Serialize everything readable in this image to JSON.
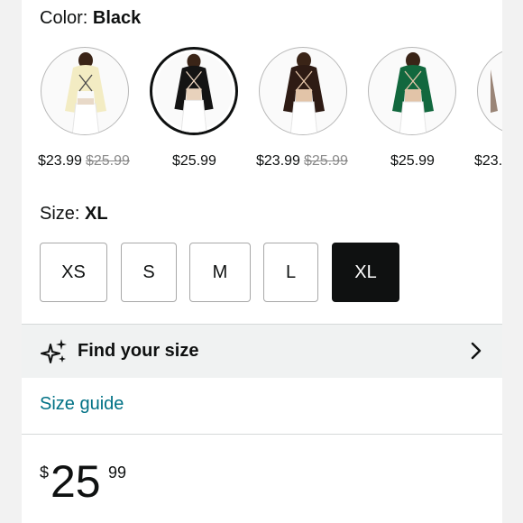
{
  "color": {
    "label": "Color:",
    "value": "Black"
  },
  "swatches": [
    {
      "name": "Cream",
      "price": "$23.99",
      "list_price": "$25.99",
      "selected": false,
      "shirt_color": "#f3ecc3"
    },
    {
      "name": "Black",
      "price": "$25.99",
      "list_price": "",
      "selected": true,
      "shirt_color": "#141414"
    },
    {
      "name": "Brown",
      "price": "$23.99",
      "list_price": "$25.99",
      "selected": false,
      "shirt_color": "#2e1b14"
    },
    {
      "name": "Green",
      "price": "$25.99",
      "list_price": "",
      "selected": false,
      "shirt_color": "#12683e"
    },
    {
      "name": "Taupe",
      "price": "$23.",
      "list_price": "",
      "selected": false,
      "shirt_color": "#9a8577"
    }
  ],
  "size": {
    "label": "Size:",
    "value": "XL",
    "options": [
      "XS",
      "S",
      "M",
      "L",
      "XL"
    ],
    "selected": "XL"
  },
  "find_size": {
    "label": "Find your size",
    "icon": "sparkle-icon",
    "chevron": "chevron-right-icon"
  },
  "size_guide": {
    "label": "Size guide"
  },
  "price": {
    "symbol": "$",
    "whole": "25",
    "fraction": "99"
  },
  "colors": {
    "link": "#007185",
    "selected": "#0f1111",
    "strike": "#8a8a8a",
    "panel": "#f0f2f2"
  }
}
